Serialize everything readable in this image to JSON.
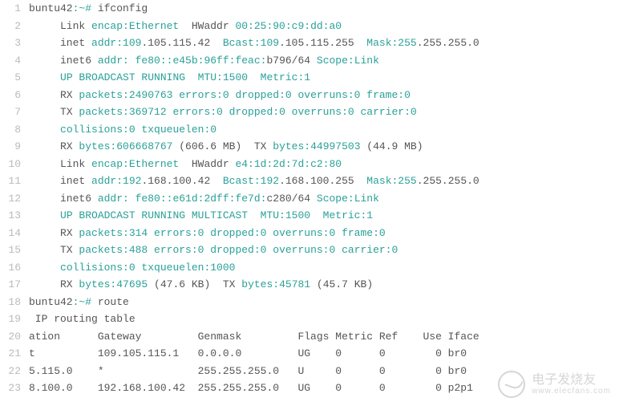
{
  "lines": [
    {
      "n": 1,
      "segments": [
        {
          "c": "t-default",
          "t": "buntu42"
        },
        {
          "c": "t-green",
          "t": ":~#"
        },
        {
          "c": "t-default",
          "t": " ifconfig"
        }
      ]
    },
    {
      "n": 2,
      "segments": [
        {
          "c": "t-default",
          "t": "     Link "
        },
        {
          "c": "t-green",
          "t": "encap:Ethernet"
        },
        {
          "c": "t-default",
          "t": "  HWaddr "
        },
        {
          "c": "t-green",
          "t": "00:25:90:c9:dd:a0"
        }
      ]
    },
    {
      "n": 3,
      "segments": [
        {
          "c": "t-default",
          "t": "     inet "
        },
        {
          "c": "t-green",
          "t": "addr:109"
        },
        {
          "c": "t-default",
          "t": ".105.115.42  "
        },
        {
          "c": "t-green",
          "t": "Bcast:109"
        },
        {
          "c": "t-default",
          "t": ".105.115.255  "
        },
        {
          "c": "t-green",
          "t": "Mask:255"
        },
        {
          "c": "t-default",
          "t": ".255.255.0"
        }
      ]
    },
    {
      "n": 4,
      "segments": [
        {
          "c": "t-default",
          "t": "     inet6 "
        },
        {
          "c": "t-green",
          "t": "addr: fe80::e45b:96ff:feac:"
        },
        {
          "c": "t-default",
          "t": "b796/64 "
        },
        {
          "c": "t-green",
          "t": "Scope:Link"
        }
      ]
    },
    {
      "n": 5,
      "segments": [
        {
          "c": "t-default",
          "t": "     "
        },
        {
          "c": "t-green",
          "t": "UP BROADCAST RUNNING  MTU:1500  Metric:1"
        }
      ]
    },
    {
      "n": 6,
      "segments": [
        {
          "c": "t-default",
          "t": "     RX "
        },
        {
          "c": "t-green",
          "t": "packets:2490763 errors:0 dropped:0 overruns:0 frame:0"
        }
      ]
    },
    {
      "n": 7,
      "segments": [
        {
          "c": "t-default",
          "t": "     TX "
        },
        {
          "c": "t-green",
          "t": "packets:369712 errors:0 dropped:0 overruns:0 carrier:0"
        }
      ]
    },
    {
      "n": 8,
      "segments": [
        {
          "c": "t-default",
          "t": "     "
        },
        {
          "c": "t-green",
          "t": "collisions:0 txqueuelen:0"
        }
      ]
    },
    {
      "n": 9,
      "segments": [
        {
          "c": "t-default",
          "t": "     RX "
        },
        {
          "c": "t-green",
          "t": "bytes:606668767"
        },
        {
          "c": "t-default",
          "t": " (606.6 MB)  TX "
        },
        {
          "c": "t-green",
          "t": "bytes:44997503"
        },
        {
          "c": "t-default",
          "t": " (44.9 MB)"
        }
      ]
    },
    {
      "n": 10,
      "segments": [
        {
          "c": "t-default",
          "t": "     Link "
        },
        {
          "c": "t-green",
          "t": "encap:Ethernet"
        },
        {
          "c": "t-default",
          "t": "  HWaddr "
        },
        {
          "c": "t-green",
          "t": "e4:1d:2d:7d:c2:80"
        }
      ]
    },
    {
      "n": 11,
      "segments": [
        {
          "c": "t-default",
          "t": "     inet "
        },
        {
          "c": "t-green",
          "t": "addr:192"
        },
        {
          "c": "t-default",
          "t": ".168.100.42  "
        },
        {
          "c": "t-green",
          "t": "Bcast:192"
        },
        {
          "c": "t-default",
          "t": ".168.100.255  "
        },
        {
          "c": "t-green",
          "t": "Mask:255"
        },
        {
          "c": "t-default",
          "t": ".255.255.0"
        }
      ]
    },
    {
      "n": 12,
      "segments": [
        {
          "c": "t-default",
          "t": "     inet6 "
        },
        {
          "c": "t-green",
          "t": "addr: fe80::e61d:2dff:fe7d:"
        },
        {
          "c": "t-default",
          "t": "c280/64 "
        },
        {
          "c": "t-green",
          "t": "Scope:Link"
        }
      ]
    },
    {
      "n": 13,
      "segments": [
        {
          "c": "t-default",
          "t": "     "
        },
        {
          "c": "t-green",
          "t": "UP BROADCAST RUNNING MULTICAST  MTU:1500  Metric:1"
        }
      ]
    },
    {
      "n": 14,
      "segments": [
        {
          "c": "t-default",
          "t": "     RX "
        },
        {
          "c": "t-green",
          "t": "packets:314 errors:0 dropped:0 overruns:0 frame:0"
        }
      ]
    },
    {
      "n": 15,
      "segments": [
        {
          "c": "t-default",
          "t": "     TX "
        },
        {
          "c": "t-green",
          "t": "packets:488 errors:0 dropped:0 overruns:0 carrier:0"
        }
      ]
    },
    {
      "n": 16,
      "segments": [
        {
          "c": "t-default",
          "t": "     "
        },
        {
          "c": "t-green",
          "t": "collisions:0 txqueuelen:1000"
        }
      ]
    },
    {
      "n": 17,
      "segments": [
        {
          "c": "t-default",
          "t": "     RX "
        },
        {
          "c": "t-green",
          "t": "bytes:47695"
        },
        {
          "c": "t-default",
          "t": " (47.6 KB)  TX "
        },
        {
          "c": "t-green",
          "t": "bytes:45781"
        },
        {
          "c": "t-default",
          "t": " (45.7 KB)"
        }
      ]
    },
    {
      "n": 18,
      "segments": [
        {
          "c": "t-default",
          "t": "buntu42"
        },
        {
          "c": "t-green",
          "t": ":~#"
        },
        {
          "c": "t-default",
          "t": " route"
        }
      ]
    },
    {
      "n": 19,
      "segments": [
        {
          "c": "t-default",
          "t": " IP routing table"
        }
      ]
    },
    {
      "n": 20,
      "segments": [
        {
          "c": "t-default",
          "t": "ation      Gateway         Genmask         Flags Metric Ref    Use Iface"
        }
      ]
    },
    {
      "n": 21,
      "segments": [
        {
          "c": "t-default",
          "t": "t          109.105.115.1   0.0.0.0         UG    0      0        0 br0"
        }
      ]
    },
    {
      "n": 22,
      "segments": [
        {
          "c": "t-default",
          "t": "5.115.0    *               255.255.255.0   U     0      0        0 br0"
        }
      ]
    },
    {
      "n": 23,
      "segments": [
        {
          "c": "t-default",
          "t": "8.100.0    192.168.100.42  255.255.255.0   UG    0      0        0 p2p1"
        }
      ]
    }
  ],
  "watermark": {
    "title": "电子发烧友",
    "url": "www.elecfans.com"
  }
}
